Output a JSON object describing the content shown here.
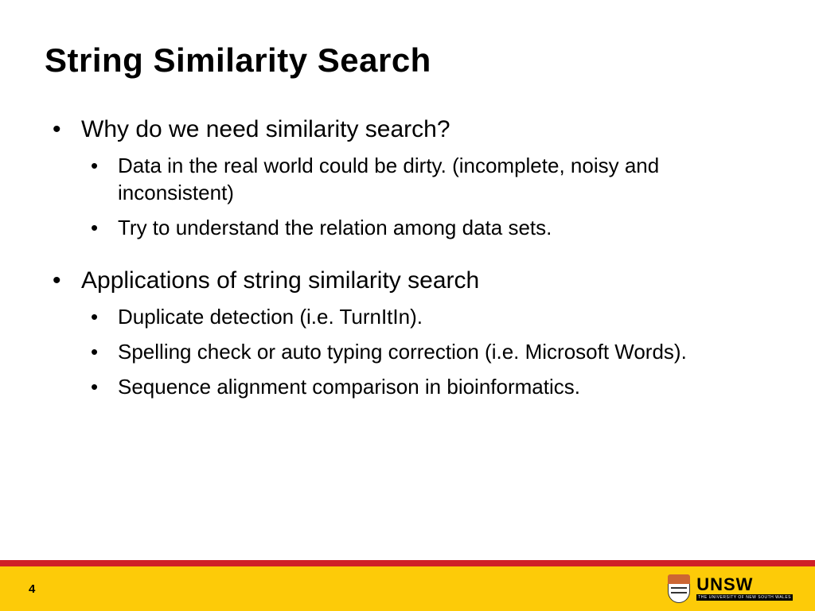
{
  "title": "String Similarity Search",
  "bullets": {
    "b1": {
      "text": "Why do we need similarity search?",
      "sub": [
        "Data in the real world could be dirty. (incomplete, noisy and inconsistent)",
        "Try to understand the relation among data sets."
      ]
    },
    "b2": {
      "text": "Applications of string similarity search",
      "sub": [
        "Duplicate detection (i.e. TurnItIn).",
        "Spelling check or auto typing correction (i.e. Microsoft Words).",
        "Sequence alignment comparison in bioinformatics."
      ]
    }
  },
  "footer": {
    "page_number": "4",
    "brand_name": "UNSW",
    "brand_subtitle": "THE UNIVERSITY OF NEW SOUTH WALES"
  },
  "colors": {
    "red": "#cf2027",
    "yellow": "#fdcb08"
  }
}
